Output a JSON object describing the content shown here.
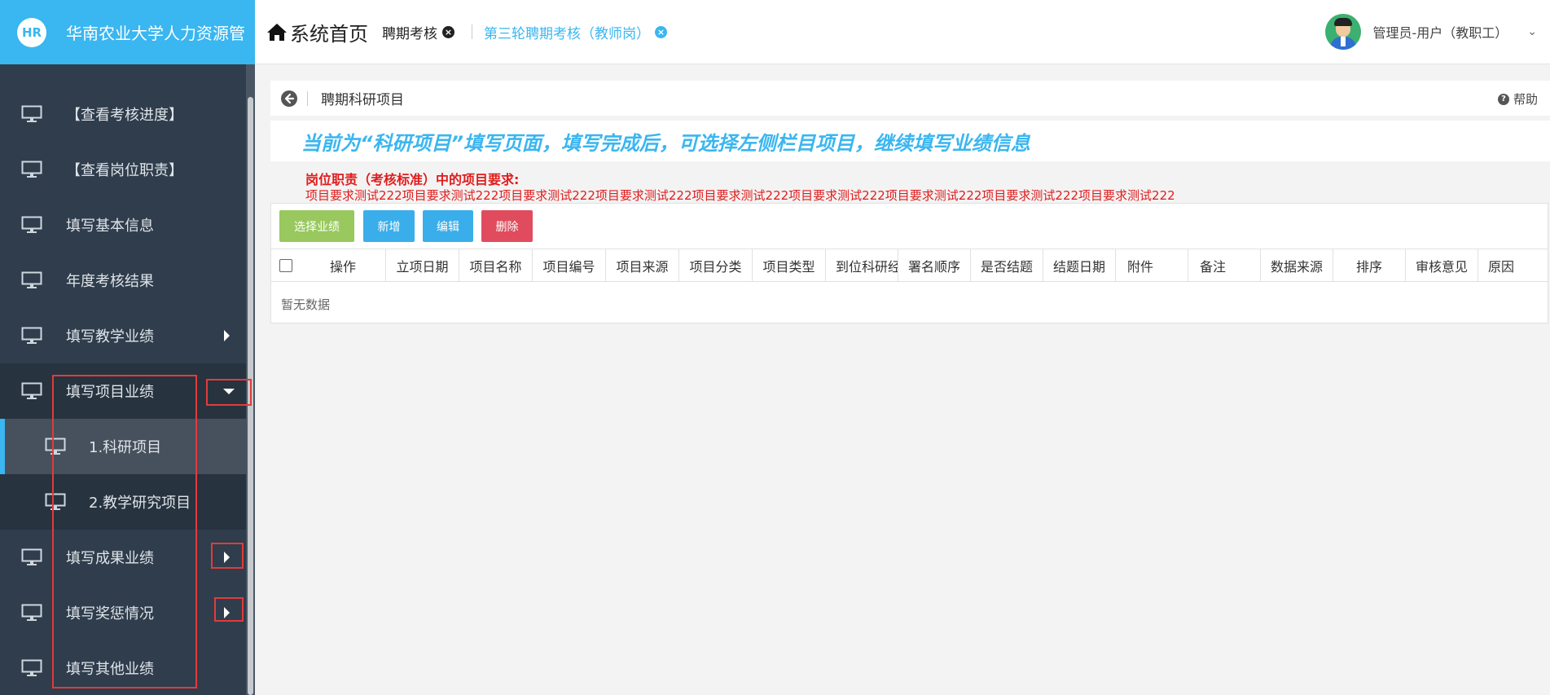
{
  "header": {
    "logo_text": "HR",
    "brand_title": "华南农业大学人力资源管",
    "home_label": "系统首页",
    "tabs": [
      {
        "label": "聘期考核",
        "close": "×"
      },
      {
        "label": "第三轮聘期考核（教师岗）",
        "close": "×"
      }
    ],
    "user_name": "管理员-用户（教职工）",
    "user_caret": "⌄"
  },
  "sidebar": {
    "items": [
      {
        "label": "【查看考核进度】"
      },
      {
        "label": "【查看岗位职责】"
      },
      {
        "label": "填写基本信息"
      },
      {
        "label": "年度考核结果"
      },
      {
        "label": "填写教学业绩"
      },
      {
        "label": "填写项目业绩"
      },
      {
        "label": "1.科研项目"
      },
      {
        "label": "2.教学研究项目"
      },
      {
        "label": "填写成果业绩"
      },
      {
        "label": "填写奖惩情况"
      },
      {
        "label": "填写其他业绩"
      }
    ]
  },
  "main": {
    "page_title": "聘期科研项目",
    "help_label": "帮助",
    "notice": "当前为“科研项目”填写页面，填写完成后，可选择左侧栏目项目，继续填写业绩信息",
    "requirement_title": "岗位职责（考核标准）中的项目要求:",
    "requirement_body": "项目要求测试222项目要求测试222项目要求测试222项目要求测试222项目要求测试222项目要求测试222项目要求测试222项目要求测试222项目要求测试222",
    "buttons": {
      "choose": "选择业绩",
      "add": "新增",
      "edit": "编辑",
      "delete": "删除"
    },
    "columns": [
      "操作",
      "立项日期",
      "项目名称",
      "项目编号",
      "项目来源",
      "项目分类",
      "项目类型",
      "到位科研经费",
      "署名顺序",
      "是否结题",
      "结题日期",
      "附件",
      "备注",
      "数据来源",
      "排序",
      "审核意见",
      "原因"
    ],
    "empty_text": "暂无数据"
  },
  "colors": {
    "accent": "#3ab6f0",
    "sidebar_bg": "#2f3d4c",
    "warning": "#e01c1c",
    "highlight_box": "#e23b3b"
  }
}
